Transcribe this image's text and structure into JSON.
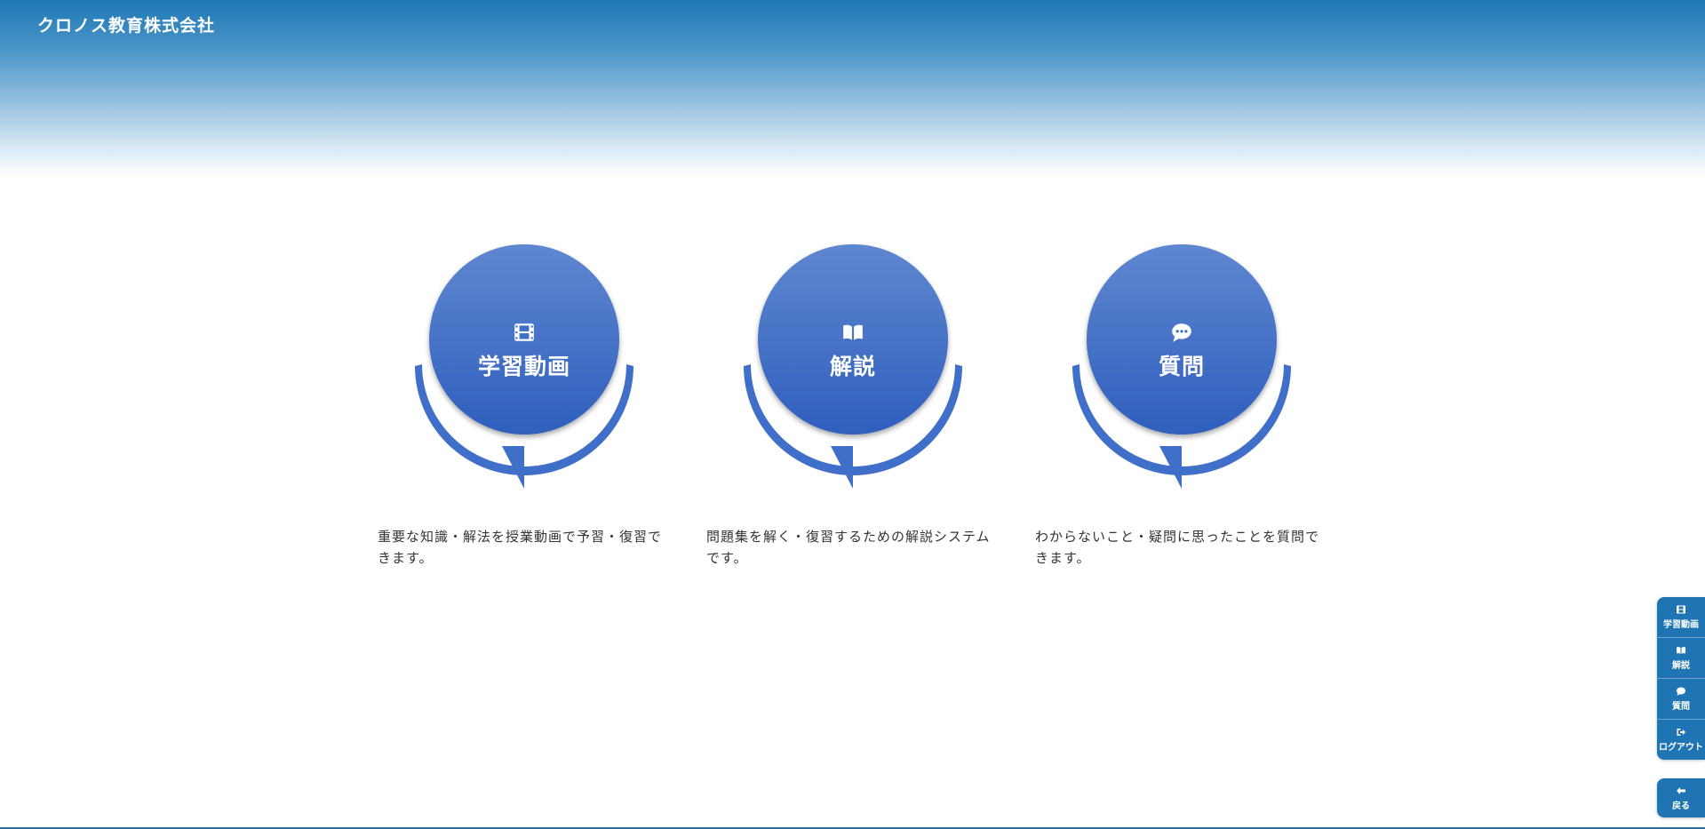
{
  "header": {
    "brand": "クロノス教育株式会社"
  },
  "cards": [
    {
      "icon": "film-icon",
      "label": "学習動画",
      "description": "重要な知識・解法を授業動画で予習・復習できます。"
    },
    {
      "icon": "book-open-icon",
      "label": "解説",
      "description": "問題集を解く・復習するための解説システムです。"
    },
    {
      "icon": "comment-dots-icon",
      "label": "質問",
      "description": "わからないこと・疑問に思ったことを質問できます。"
    }
  ],
  "side_nav": {
    "items": [
      {
        "icon": "film-icon",
        "label": "学習動画"
      },
      {
        "icon": "book-open-icon",
        "label": "解説"
      },
      {
        "icon": "comment-dots-icon",
        "label": "質問"
      },
      {
        "icon": "sign-out-icon",
        "label": "ログアウト"
      }
    ],
    "back": {
      "icon": "arrow-left-icon",
      "label": "戻る"
    }
  },
  "colors": {
    "header_top": "#1f78b4",
    "circle_top": "#5f87d0",
    "circle_bottom": "#2f5fbe",
    "ring": "#3f6fc8",
    "nav": "#1f74b3"
  }
}
